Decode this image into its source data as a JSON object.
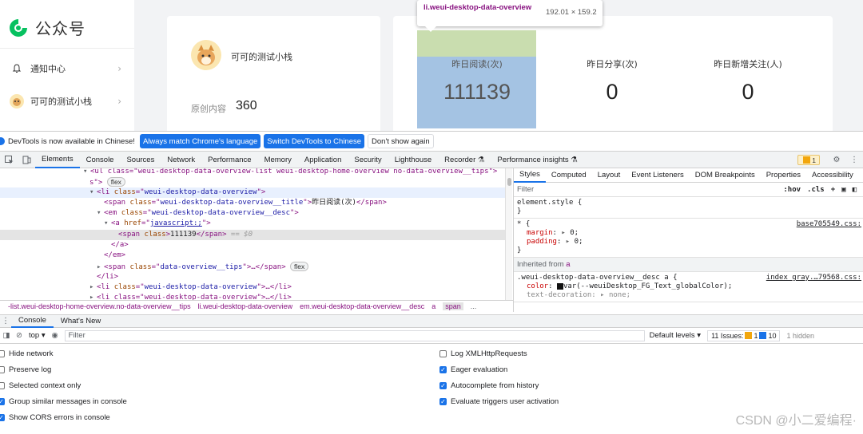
{
  "page": {
    "logo_text": "公众号",
    "nav": [
      {
        "label": "通知中心",
        "icon": "bell-icon"
      },
      {
        "label": "可可的测试小栈",
        "icon": "avatar-icon"
      }
    ],
    "account": {
      "name": "可可的测试小栈",
      "stat_label": "原创内容",
      "stat_value": "360"
    },
    "metrics": [
      {
        "title": "昨日阅读(次)",
        "value": "111139"
      },
      {
        "title": "昨日分享(次)",
        "value": "0"
      },
      {
        "title": "昨日新增关注(人)",
        "value": "0"
      }
    ],
    "highlight_colors": {
      "margin": "#c3d9a6",
      "content": "#a4c3e3"
    }
  },
  "tooltip": {
    "selector": "li.weui-desktop-data-overview",
    "size": "192.01 × 159.2"
  },
  "devtools": {
    "infobar": {
      "text": "DevTools is now available in Chinese!",
      "btn_match": "Always match Chrome's language",
      "btn_switch": "Switch DevTools to Chinese",
      "btn_dismiss": "Don't show again"
    },
    "tabs": [
      "Elements",
      "Console",
      "Sources",
      "Network",
      "Performance",
      "Memory",
      "Application",
      "Security",
      "Lighthouse",
      "Recorder",
      "Performance insights"
    ],
    "issues_count": "1",
    "dom": {
      "l0_text": "<ul class=\"weui-desktop-data-overview-list weui-desktop-home-overview no-data-overview__tips\">",
      "l1_text": "s\">",
      "l1_pill": "flex",
      "l2_tag": "li",
      "l2_attr": "class",
      "l2_val": "weui-desktop-data-overview",
      "l3_tag": "span",
      "l3_attr": "class",
      "l3_val": "weui-desktop-data-overview__title",
      "l3_text": "昨日阅读(次)",
      "l4_tag": "em",
      "l4_attr": "class",
      "l4_val": "weui-desktop-data-overview__desc",
      "l5_tag": "a",
      "l5_attr": "href",
      "l5_val": "javascript:;",
      "l6_tag": "span",
      "l6_attr": "class",
      "l6_text": "111139",
      "l6_eq": "== $0",
      "l7": "</a>",
      "l8": "</em>",
      "l9_tag": "span",
      "l9_attr": "class",
      "l9_val": "data-overview__tips",
      "l9_text": "…</span>",
      "l9_pill": "flex",
      "l10": "</li>",
      "l11_tag": "li",
      "l11_attr": "class",
      "l11_val": "weui-desktop-data-overview",
      "l11_text": "…</li>",
      "l12_text": "<li class=\"weui-desktop-data-overview\">…</li>"
    },
    "breadcrumbs": [
      "-list.weui-desktop-home-overview.no-data-overview__tips",
      "li.weui-desktop-data-overview",
      "em.weui-desktop-data-overview__desc",
      "a",
      "span",
      "..."
    ],
    "styles_tabs": [
      "Styles",
      "Computed",
      "Layout",
      "Event Listeners",
      "DOM Breakpoints",
      "Properties",
      "Accessibility"
    ],
    "filter_placeholder": "Filter",
    "filter_actions": [
      ":hov",
      ".cls",
      "+"
    ],
    "rules": {
      "element_style": "element.style {",
      "close": "}",
      "star_selector": "* {",
      "star_source": "base705549.css:",
      "margin_prop": "margin",
      "margin_val": "0;",
      "padding_prop": "padding",
      "padding_val": "0;",
      "inherited_label": "Inherited from",
      "inherited_tag": "a",
      "desc_selector": ".weui-desktop-data-overview__desc a {",
      "desc_source": "index_gray.…79568.css:",
      "color_prop": "color",
      "color_val": "var(--weuiDesktop_FG_Text_globalColor);",
      "deco_prop": "text-decoration",
      "deco_val": "none;"
    },
    "drawer_tabs": [
      "Console",
      "What's New"
    ],
    "console": {
      "context": "top",
      "filter_placeholder": "Filter",
      "levels": "Default levels",
      "issues_label": "11 Issues:",
      "issues_warn": "1",
      "issues_info": "10",
      "hidden": "1 hidden"
    },
    "settings_left": [
      {
        "label": "Hide network",
        "checked": false
      },
      {
        "label": "Preserve log",
        "checked": false
      },
      {
        "label": "Selected context only",
        "checked": false
      },
      {
        "label": "Group similar messages in console",
        "checked": true
      },
      {
        "label": "Show CORS errors in console",
        "checked": true
      }
    ],
    "settings_right": [
      {
        "label": "Log XMLHttpRequests",
        "checked": false
      },
      {
        "label": "Eager evaluation",
        "checked": true
      },
      {
        "label": "Autocomplete from history",
        "checked": true
      },
      {
        "label": "Evaluate triggers user activation",
        "checked": true
      }
    ]
  },
  "watermark": "CSDN @小二爱编程·"
}
